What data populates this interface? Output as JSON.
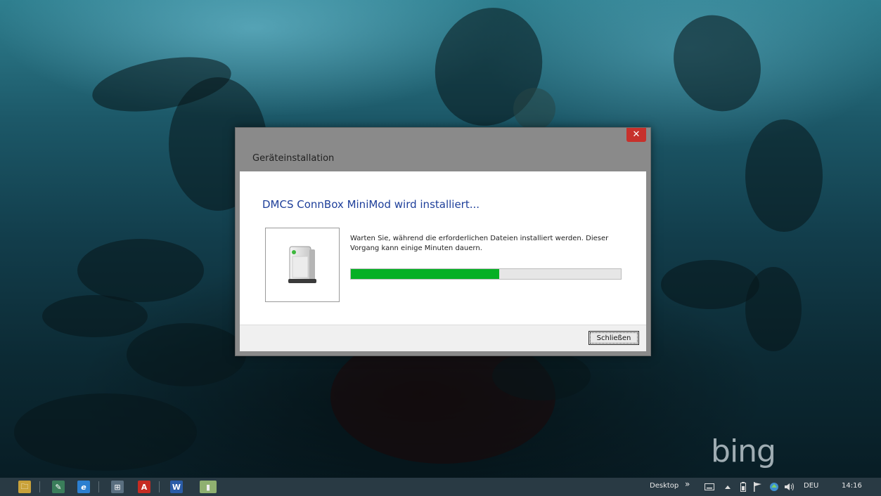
{
  "desktop": {
    "watermark": "bing"
  },
  "dialog": {
    "title": "Geräteinstallation",
    "close_icon": "close-icon",
    "close_symbol": "✕",
    "heading": "DMCS ConnBox MiniMod wird installiert...",
    "description": "Warten Sie, während die erforderlichen Dateien installiert werden. Dieser Vorgang kann einige Minuten dauern.",
    "progress_percent": 55,
    "close_button_label": "Schließen",
    "colors": {
      "heading": "#1e3f9a",
      "progress": "#06b025",
      "close": "#c7312c"
    }
  },
  "taskbar": {
    "pinned": [
      {
        "name": "file-explorer-icon",
        "glyph": "🗀"
      },
      {
        "name": "notepad-icon",
        "glyph": "✎"
      },
      {
        "name": "internet-explorer-icon",
        "glyph": "e"
      },
      {
        "name": "device-manager-icon",
        "glyph": "⊞"
      },
      {
        "name": "acrobat-icon",
        "glyph": "A"
      },
      {
        "name": "word-icon",
        "glyph": "W"
      },
      {
        "name": "device-installer-icon",
        "glyph": "▮"
      }
    ],
    "toolbar_label": "Desktop",
    "toolbar_chevron": "»",
    "language": "DEU",
    "time": "14:16"
  }
}
